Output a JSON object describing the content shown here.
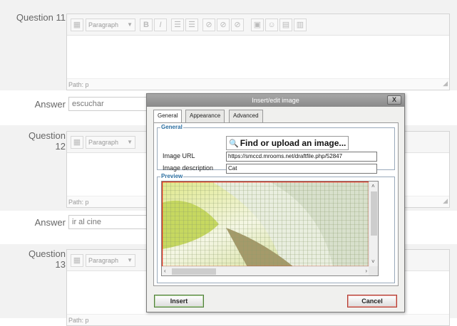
{
  "questions": [
    {
      "label": "Question 11",
      "toolbar_format": "Paragraph",
      "path": "Path: p",
      "answer_label": "Answer",
      "answer_value": "escuchar"
    },
    {
      "label": "Question 12",
      "toolbar_format": "Paragraph",
      "path": "Path: p",
      "answer_label": "Answer",
      "answer_value": "ir al cine"
    },
    {
      "label": "Question 13",
      "toolbar_format": "Paragraph",
      "path": "Path: p"
    }
  ],
  "toolbar_icons": [
    "B",
    "I",
    "☰",
    "☰",
    "⊘",
    "⊘",
    "⊘",
    "▣",
    "☺",
    "▤",
    "▥"
  ],
  "dialog": {
    "title": "Insert/edit image",
    "close_label": "X",
    "tabs": [
      "General",
      "Appearance",
      "Advanced"
    ],
    "general_legend": "General",
    "find_button": "Find or upload an image...",
    "image_url_label": "Image URL",
    "image_url_value": "https://smccd.mrooms.net/draftfile.php/52847",
    "image_desc_label": "Image description",
    "image_desc_value": "Cat",
    "preview_legend": "Preview",
    "insert_label": "Insert",
    "cancel_label": "Cancel"
  },
  "colors": {
    "legend": "#2b6ea0",
    "insert_border": "#4f7d3a",
    "cancel_border": "#b23a30"
  }
}
